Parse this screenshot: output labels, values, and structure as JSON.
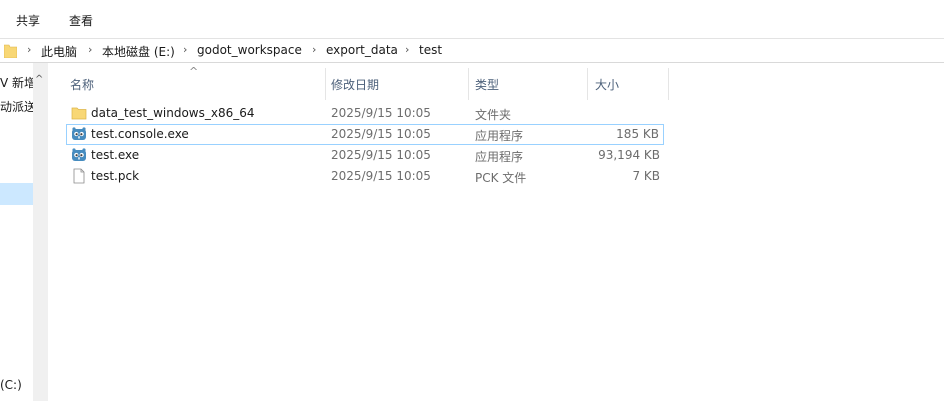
{
  "ribbon": {
    "tabs": [
      "共享",
      "查看"
    ]
  },
  "address": {
    "breadcrumbs": [
      "此电脑",
      "本地磁盘 (E:)",
      "godot_workspace",
      "export_data",
      "test"
    ]
  },
  "navpane": {
    "items": [
      "V 新增",
      "动派送",
      "(C:)"
    ]
  },
  "columns": {
    "name": "名称",
    "date": "修改日期",
    "type": "类型",
    "size": "大小"
  },
  "files": [
    {
      "name": "data_test_windows_x86_64",
      "date": "2025/9/15 10:05",
      "type": "文件夹",
      "size": "",
      "icon": "folder-icon"
    },
    {
      "name": "test.console.exe",
      "date": "2025/9/15 10:05",
      "type": "应用程序",
      "size": "185 KB",
      "icon": "godot-app-icon"
    },
    {
      "name": "test.exe",
      "date": "2025/9/15 10:05",
      "type": "应用程序",
      "size": "93,194 KB",
      "icon": "godot-app-icon"
    },
    {
      "name": "test.pck",
      "date": "2025/9/15 10:05",
      "type": "PCK 文件",
      "size": "7 KB",
      "icon": "file-icon"
    }
  ],
  "colors": {
    "selection": "#cce8ff",
    "focus_border": "#99d1ff",
    "header_text": "#4c607a",
    "folder": "#f8d775",
    "godot_blue": "#478cbf"
  }
}
